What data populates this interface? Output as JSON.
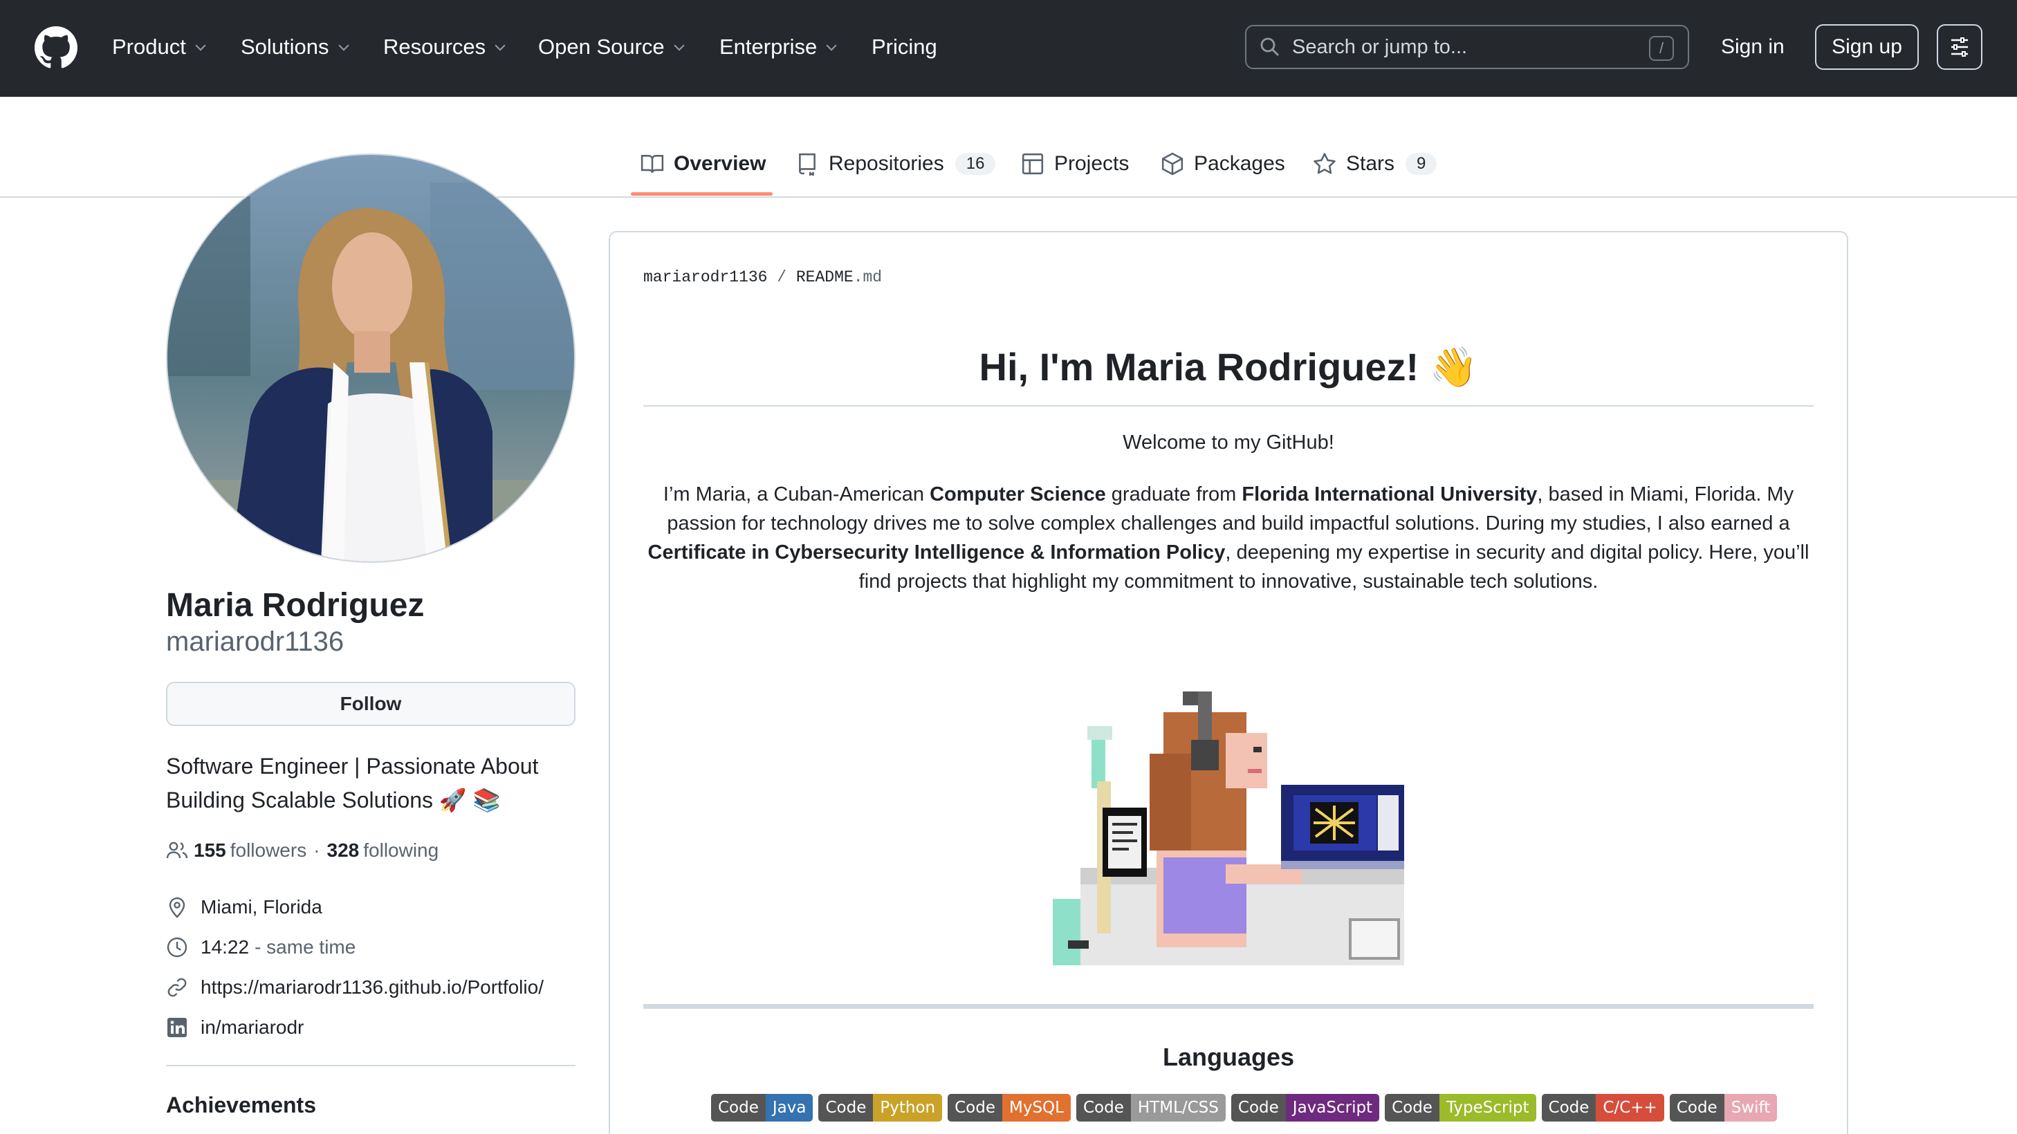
{
  "header": {
    "nav": [
      {
        "label": "Product",
        "dropdown": true
      },
      {
        "label": "Solutions",
        "dropdown": true
      },
      {
        "label": "Resources",
        "dropdown": true
      },
      {
        "label": "Open Source",
        "dropdown": true
      },
      {
        "label": "Enterprise",
        "dropdown": true
      },
      {
        "label": "Pricing",
        "dropdown": false
      }
    ],
    "search_placeholder": "Search or jump to...",
    "search_shortcut": "/",
    "sign_in": "Sign in",
    "sign_up": "Sign up"
  },
  "tabs": [
    {
      "label": "Overview",
      "icon": "book-icon",
      "active": true
    },
    {
      "label": "Repositories",
      "icon": "repo-icon",
      "count": "16"
    },
    {
      "label": "Projects",
      "icon": "table-icon"
    },
    {
      "label": "Packages",
      "icon": "package-icon"
    },
    {
      "label": "Stars",
      "icon": "star-icon",
      "count": "9"
    }
  ],
  "profile": {
    "name": "Maria Rodriguez",
    "username": "mariarodr1136",
    "follow_label": "Follow",
    "bio_line1": "Software Engineer | Passionate About",
    "bio_line2": "Building Scalable Solutions 🚀 📚",
    "followers": "155",
    "followers_label": "followers",
    "separator": "·",
    "following": "328",
    "following_label": "following",
    "location": "Miami, Florida",
    "time": "14:22",
    "time_note": "- same time",
    "website": "https://mariarodr1136.github.io/Portfolio/",
    "linkedin": "in/mariarodr",
    "achievements_label": "Achievements"
  },
  "readme": {
    "owner": "mariarodr1136",
    "path_sep": "/",
    "file_base": "README",
    "file_ext": ".md",
    "title": "Hi, I'm Maria Rodriguez! 👋",
    "welcome": "Welcome to my GitHub!",
    "intro_1": "I’m Maria, a Cuban-American ",
    "intro_bold_1": "Computer Science",
    "intro_2": " graduate from ",
    "intro_bold_2": "Florida International University",
    "intro_3": ", based in Miami, Florida. My passion for technology drives me to solve complex challenges and build impactful solutions. During my studies, I also earned a ",
    "intro_bold_3": "Certificate in Cybersecurity Intelligence & Information Policy",
    "intro_4": ", deepening my expertise in security and digital policy. Here, you’ll find projects that highlight my commitment to innovative, sustainable tech solutions.",
    "languages_title": "Languages",
    "badges": [
      {
        "label": "Code",
        "value": "Java",
        "color": "#3572b0"
      },
      {
        "label": "Code",
        "value": "Python",
        "color": "#c9a227"
      },
      {
        "label": "Code",
        "value": "MySQL",
        "color": "#e0712f"
      },
      {
        "label": "Code",
        "value": "HTML/CSS",
        "color": "#9a9a9a"
      },
      {
        "label": "Code",
        "value": "JavaScript",
        "color": "#6e2a7e"
      },
      {
        "label": "Code",
        "value": "TypeScript",
        "color": "#9bbb2a"
      },
      {
        "label": "Code",
        "value": "C/C++",
        "color": "#d64d3c"
      },
      {
        "label": "Code",
        "value": "Swift",
        "color": "#e8a7b2"
      }
    ]
  }
}
